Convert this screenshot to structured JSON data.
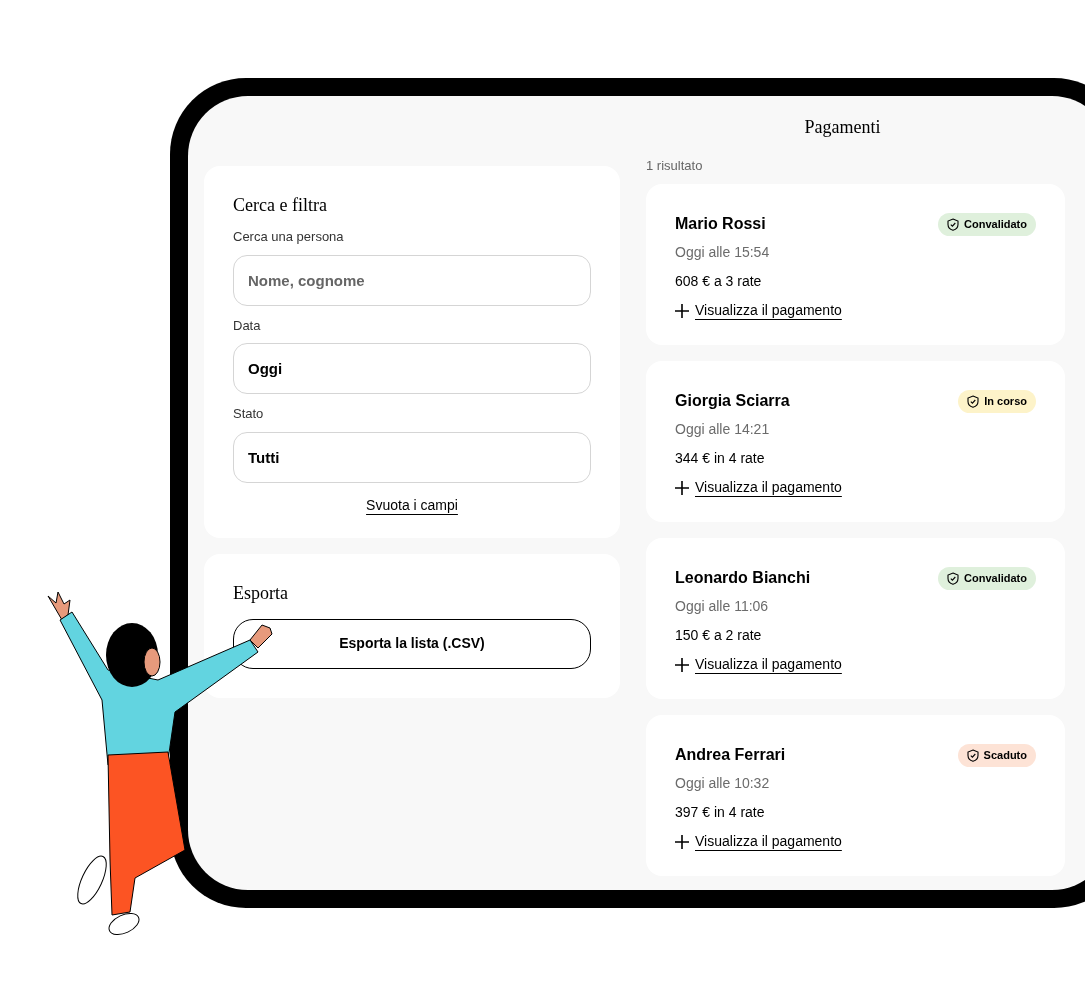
{
  "title": "Pagamenti",
  "filters": {
    "title": "Cerca e filtra",
    "fields": [
      {
        "label": "Cerca una persona",
        "placeholder": "Nome, cognome"
      },
      {
        "label": "Data",
        "value": "Oggi"
      },
      {
        "label": "Stato",
        "value": "Tutti"
      }
    ],
    "clear_link": "Svuota i campi"
  },
  "export": {
    "title": "Esporta",
    "button": "Esporta la lista (.CSV)"
  },
  "results_count": "1 risultato",
  "payments": [
    {
      "name": "Mario Rossi",
      "time": "Oggi alle 15:54",
      "amount": "608 € a 3 rate",
      "status": "Convalidato",
      "color": "#dff0dc",
      "link": "Visualizza il pagamento"
    },
    {
      "name": "Giorgia Sciarra",
      "time": "Oggi alle 14:21",
      "amount": "344 € in 4 rate",
      "status": "In corso",
      "color": "#fdf3c9",
      "link": "Visualizza il pagamento"
    },
    {
      "name": "Leonardo Bianchi",
      "time": "Oggi alle 11:06",
      "amount": "150 € a 2 rate",
      "status": "Convalidato",
      "color": "#dff0dc",
      "link": "Visualizza il pagamento"
    },
    {
      "name": "Andrea Ferrari",
      "time": "Oggi alle 10:32",
      "amount": "397 € in 4 rate",
      "status": "Scaduto",
      "color": "#fde3d6",
      "link": "Visualizza il pagamento"
    }
  ]
}
